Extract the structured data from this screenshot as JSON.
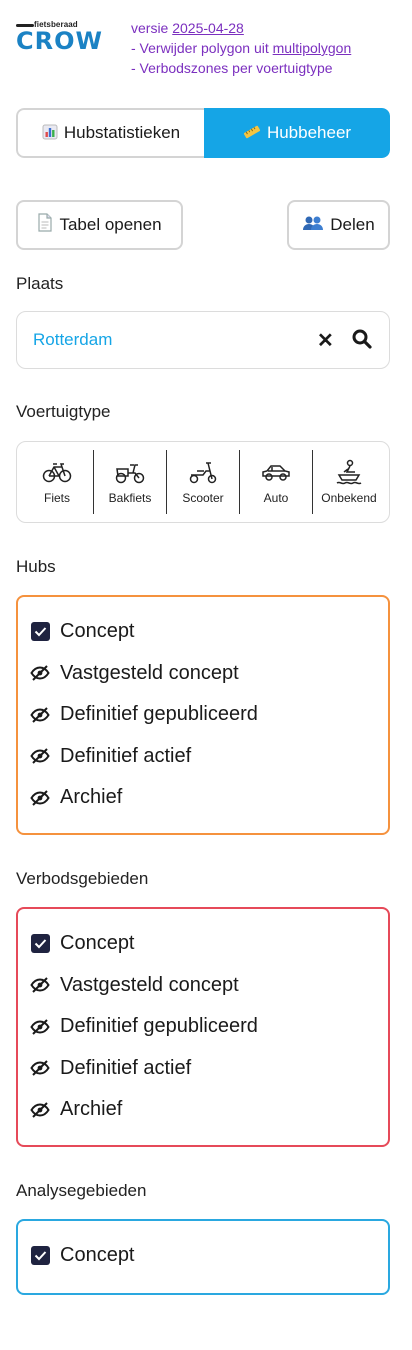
{
  "header": {
    "logo_small": "fietsberaad",
    "logo_main": "CROW",
    "version_prefix": "versie ",
    "version_date": "2025-04-28",
    "changelog_line1_prefix": "- Verwijder polygon uit ",
    "changelog_line1_link": "multipolygon",
    "changelog_line2": "- Verbodszones per voertuigtype",
    "accent_color": "#7b2fbf"
  },
  "tabs": [
    {
      "label": "Hubstatistieken",
      "icon": "bar-chart-icon",
      "active": false
    },
    {
      "label": "Hubbeheer",
      "icon": "ruler-icon",
      "active": true
    }
  ],
  "actions": {
    "table_label": "Tabel openen",
    "share_label": "Delen"
  },
  "place": {
    "label": "Plaats",
    "value": "Rotterdam"
  },
  "vehicle_type": {
    "label": "Voertuigtype",
    "items": [
      "Fiets",
      "Bakfiets",
      "Scooter",
      "Auto",
      "Onbekend"
    ]
  },
  "hubs": {
    "label": "Hubs",
    "color": "#f5923e",
    "items": [
      {
        "label": "Concept",
        "checked": true
      },
      {
        "label": "Vastgesteld concept",
        "checked": false
      },
      {
        "label": "Definitief gepubliceerd",
        "checked": false
      },
      {
        "label": "Definitief actief",
        "checked": false
      },
      {
        "label": "Archief",
        "checked": false
      }
    ]
  },
  "verbodsgebieden": {
    "label": "Verbodsgebieden",
    "color": "#e64a59",
    "items": [
      {
        "label": "Concept",
        "checked": true
      },
      {
        "label": "Vastgesteld concept",
        "checked": false
      },
      {
        "label": "Definitief gepubliceerd",
        "checked": false
      },
      {
        "label": "Definitief actief",
        "checked": false
      },
      {
        "label": "Archief",
        "checked": false
      }
    ]
  },
  "analysegebieden": {
    "label": "Analysegebieden",
    "color": "#2aa8e0",
    "items": [
      {
        "label": "Concept",
        "checked": true
      }
    ]
  }
}
